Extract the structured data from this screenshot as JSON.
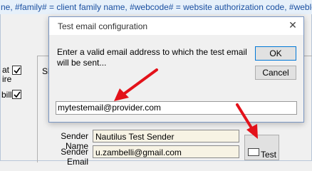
{
  "background": {
    "top_strip_text": "ne, #family# = client family name, #webcode# = website authorization code, #weblogbook#",
    "side_labels": {
      "at": "at",
      "ire": "ire",
      "bill": "bill"
    },
    "inner_clip": "Sl",
    "sender_name_label": "Sender Name",
    "sender_name_value": "Nautilus Test Sender",
    "sender_email_label": "Sender Email",
    "sender_email_value": "u.zambelli@gmail.com",
    "test_button_label": "Test"
  },
  "dialog": {
    "title": "Test email configuration",
    "close_glyph": "✕",
    "prompt_line1": "Enter a valid email address to which the test email",
    "prompt_line2": "will be sent...",
    "ok_label": "OK",
    "cancel_label": "Cancel",
    "email_value": "mytestemail@provider.com"
  },
  "colors": {
    "annotation_arrow": "#e3121a",
    "dialog_border": "#7a96c2",
    "field_background": "#f7f3e4"
  }
}
